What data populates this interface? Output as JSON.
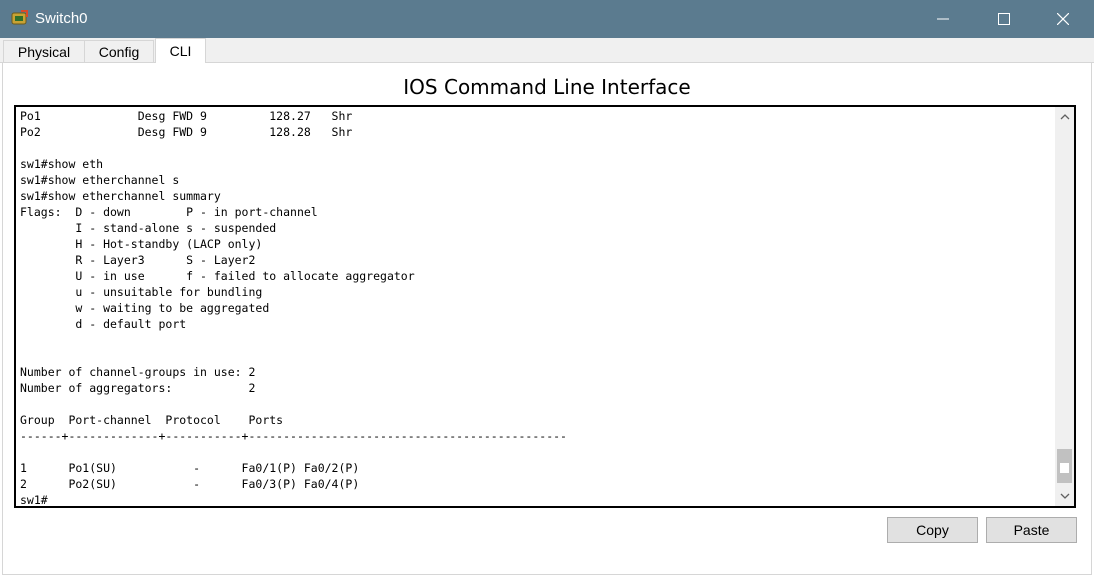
{
  "window": {
    "title": "Switch0",
    "icon": "switch-app-icon",
    "titlebar_color": "#5b7b8f"
  },
  "tabs": [
    {
      "label": "Physical",
      "active": false
    },
    {
      "label": "Config",
      "active": false
    },
    {
      "label": "CLI",
      "active": true
    }
  ],
  "heading": "IOS Command Line Interface",
  "console": {
    "lines": [
      "Po1              Desg FWD 9         128.27   Shr",
      "Po2              Desg FWD 9         128.28   Shr",
      "",
      "sw1#show eth",
      "sw1#show etherchannel s",
      "sw1#show etherchannel summary",
      "Flags:  D - down        P - in port-channel",
      "        I - stand-alone s - suspended",
      "        H - Hot-standby (LACP only)",
      "        R - Layer3      S - Layer2",
      "        U - in use      f - failed to allocate aggregator",
      "        u - unsuitable for bundling",
      "        w - waiting to be aggregated",
      "        d - default port",
      "",
      "",
      "Number of channel-groups in use: 2",
      "Number of aggregators:           2",
      "",
      "Group  Port-channel  Protocol    Ports",
      "------+-------------+-----------+----------------------------------------------",
      "",
      "1      Po1(SU)           -      Fa0/1(P) Fa0/2(P)",
      "2      Po2(SU)           -      Fa0/3(P) Fa0/4(P)",
      "sw1#"
    ]
  },
  "buttons": {
    "copy": "Copy",
    "paste": "Paste"
  }
}
